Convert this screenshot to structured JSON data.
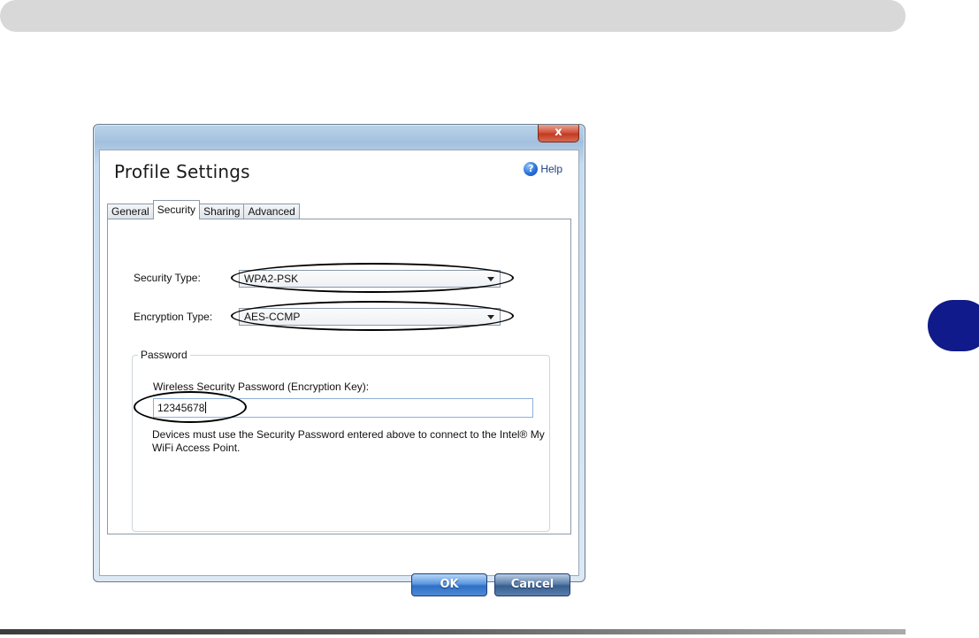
{
  "dialog": {
    "close_label": "x",
    "title": "Profile Settings",
    "help_label": "Help",
    "help_icon": "?"
  },
  "tabs": [
    {
      "label": "General",
      "active": false
    },
    {
      "label": "Security",
      "active": true
    },
    {
      "label": "Sharing",
      "active": false
    },
    {
      "label": "Advanced",
      "active": false
    }
  ],
  "security": {
    "security_type_label": "Security Type:",
    "security_type_value": "WPA2-PSK",
    "encryption_type_label": "Encryption Type:",
    "encryption_type_value": "AES-CCMP"
  },
  "password": {
    "group_label": "Password",
    "field_label": "Wireless Security Password (Encryption Key):",
    "value": "12345678",
    "description": "Devices must use the Security Password entered above to connect to the Intel® My WiFi Access Point."
  },
  "buttons": {
    "ok": "OK",
    "cancel": "Cancel"
  },
  "colors": {
    "accent": "#101a8a",
    "header_bar": "#d8d8d8"
  }
}
